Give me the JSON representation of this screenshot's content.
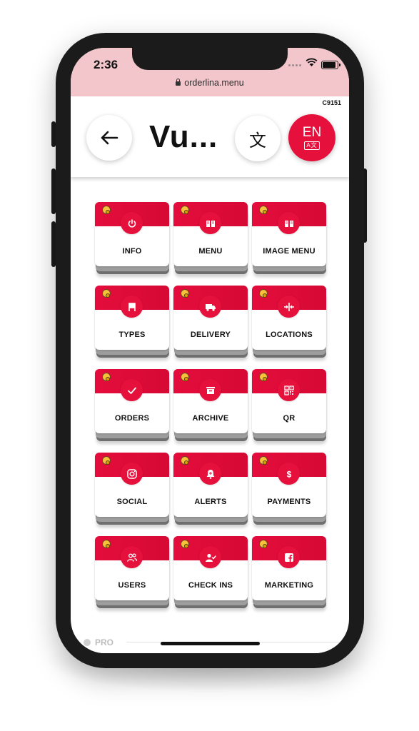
{
  "status_bar": {
    "time": "2:36",
    "url": "orderlina.menu"
  },
  "header": {
    "code": "C9151",
    "title": "Vu...",
    "back_icon": "arrow-left-icon",
    "translate_glyph": "文",
    "lang_code": "EN",
    "lang_sub": "A文"
  },
  "tiles": [
    {
      "label": "INFO",
      "icon": "power-icon"
    },
    {
      "label": "MENU",
      "icon": "book-open-icon"
    },
    {
      "label": "IMAGE MENU",
      "icon": "book-open-icon"
    },
    {
      "label": "TYPES",
      "icon": "chair-icon"
    },
    {
      "label": "DELIVERY",
      "icon": "truck-icon"
    },
    {
      "label": "LOCATIONS",
      "icon": "arrows-h-icon"
    },
    {
      "label": "ORDERS",
      "icon": "check-icon"
    },
    {
      "label": "ARCHIVE",
      "icon": "archive-icon"
    },
    {
      "label": "QR",
      "icon": "qr-code-icon"
    },
    {
      "label": "SOCIAL",
      "icon": "instagram-icon"
    },
    {
      "label": "ALERTS",
      "icon": "bell-icon"
    },
    {
      "label": "PAYMENTS",
      "icon": "dollar-icon"
    },
    {
      "label": "USERS",
      "icon": "users-icon"
    },
    {
      "label": "CHECK INS",
      "icon": "user-check-icon"
    },
    {
      "label": "MARKETING",
      "icon": "facebook-icon"
    }
  ],
  "footer": {
    "pro_label": "PRO"
  },
  "colors": {
    "accent": "#e5103c",
    "status_bar_bg": "#f3c6cc"
  }
}
